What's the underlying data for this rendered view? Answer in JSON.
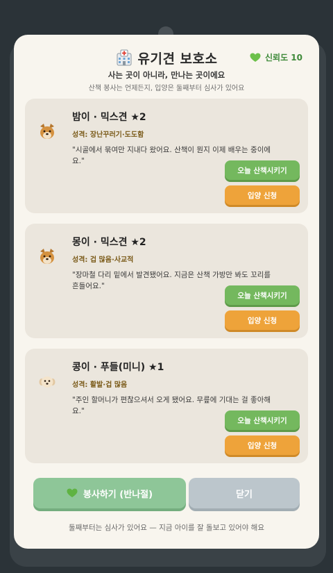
{
  "header": {
    "icon": "hospital-icon",
    "title": "유기견 보호소",
    "trust_label": "신뢰도 10",
    "trust_icon": "heart-icon",
    "subtitle": "사는 곳이 아니라, 만나는 곳이에요",
    "subnote": "산책 봉사는 언제든지, 입양은 둘째부터 심사가 있어요"
  },
  "dogs": [
    {
      "name": "밤이 · 믹스견 ★2",
      "trait": "성격: 장난꾸러기·도도함",
      "quote": "\"시골에서 묶여만 지내다 왔어요. 산책이 뭔지 이제 배우는 중이에요.\"",
      "walk_label": "오늘 산책시키기",
      "adopt_label": "입양 신청",
      "avatar": "dog-brown-icon"
    },
    {
      "name": "몽이 · 믹스견 ★2",
      "trait": "성격: 겁 많음·사교적",
      "quote": "\"장마철 다리 밑에서 발견됐어요. 지금은 산책 가방만 봐도 꼬리를 흔들어요.\"",
      "walk_label": "오늘 산책시키기",
      "adopt_label": "입양 신청",
      "avatar": "dog-brown-icon"
    },
    {
      "name": "콩이 · 푸들(미니) ★1",
      "trait": "성격: 활발·겁 많음",
      "quote": "\"주인 할머니가 편찮으셔서 오게 됐어요. 무릎에 기대는 걸 좋아해요.\"",
      "walk_label": "오늘 산책시키기",
      "adopt_label": "입양 신청",
      "avatar": "dog-cream-icon"
    }
  ],
  "footer": {
    "volunteer_label": "봉사하기 (반나절)",
    "close_label": "닫기",
    "note": "둘째부터는 심사가 있어요 — 지금 아이를 잘 돌보고 있어야 해요"
  },
  "colors": {
    "walk_button": "#74b85e",
    "adopt_button": "#eea33a",
    "volunteer_button": "#8ec698",
    "close_button": "#bcc6cc",
    "trust_text": "#3f8a3a"
  }
}
